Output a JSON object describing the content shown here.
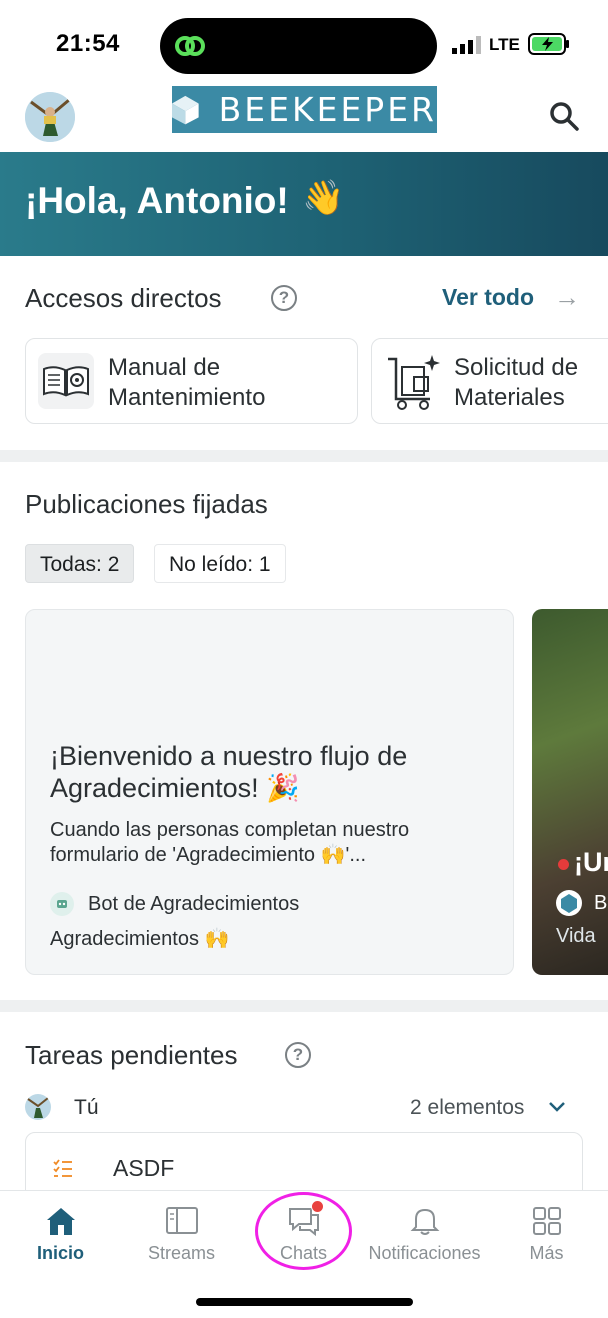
{
  "status_bar": {
    "time": "21:54",
    "network": "LTE"
  },
  "header": {
    "brand": "BEEKEEPER"
  },
  "banner": {
    "greeting": "¡Hola, Antonio!",
    "emoji": "👋"
  },
  "accesos": {
    "title": "Accesos directos",
    "ver_todo": "Ver todo",
    "items": [
      {
        "line1": "Manual de",
        "line2": "Mantenimiento"
      },
      {
        "line1": "Solicitud de",
        "line2": "Materiales"
      }
    ]
  },
  "publicaciones": {
    "title": "Publicaciones fijadas",
    "filters": [
      "Todas: 2",
      "No leído: 1"
    ],
    "cards": [
      {
        "title": "¡Bienvenido a nuestro flujo de Agradecimientos! 🎉",
        "body": "Cuando las personas completan nuestro formulario de 'Agradecimiento 🙌'...",
        "author": "Bot de Agradecimientos",
        "stream": "Agradecimientos 🙌"
      },
      {
        "title": "¡Un",
        "author": "B",
        "stream": "Vida"
      }
    ]
  },
  "tareas": {
    "title": "Tareas pendientes",
    "user": "Tú",
    "count": "2 elementos",
    "items": [
      {
        "label": "ASDF"
      }
    ]
  },
  "tabbar": {
    "tabs": [
      "Inicio",
      "Streams",
      "Chats",
      "Notificaciones",
      "Más"
    ]
  },
  "colors": {
    "accent": "#1f5f7a",
    "banner": "#1e6274",
    "unread_dot": "#e8423f",
    "highlight": "#f020e6"
  }
}
